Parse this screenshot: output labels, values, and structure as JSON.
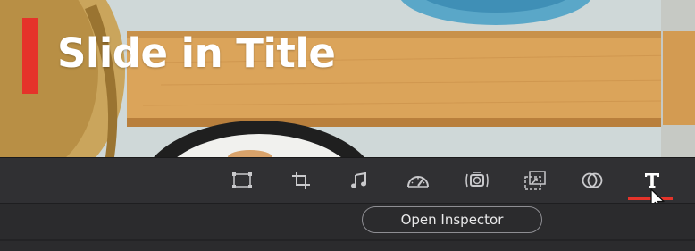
{
  "viewer": {
    "title_text": "Slide in Title"
  },
  "toolbar": {
    "tools": [
      {
        "icon": "transform-icon"
      },
      {
        "icon": "crop-icon"
      },
      {
        "icon": "audio-icon"
      },
      {
        "icon": "speed-icon"
      },
      {
        "icon": "stabilization-icon"
      },
      {
        "icon": "lens-correction-icon"
      },
      {
        "icon": "composite-icon"
      },
      {
        "icon": "text-tool-icon",
        "active": true
      }
    ]
  },
  "footer": {
    "open_inspector_label": "Open Inspector"
  },
  "colors": {
    "accent": "#e5332a",
    "toolbar_bg": "#303033",
    "icon": "#c9c9cc",
    "text": "#ffffff"
  }
}
